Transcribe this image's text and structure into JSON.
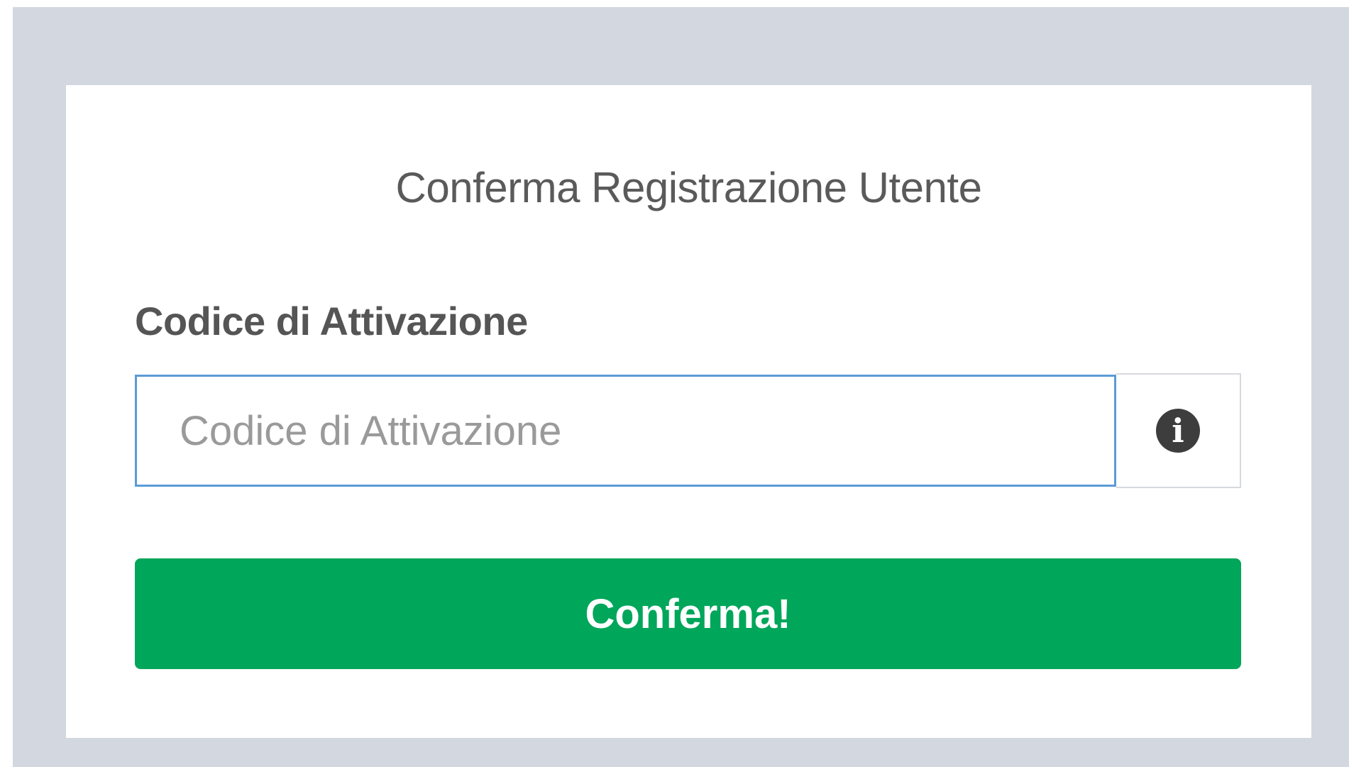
{
  "form": {
    "title": "Conferma Registrazione Utente",
    "activation_code": {
      "label": "Codice di Attivazione",
      "placeholder": "Codice di Attivazione",
      "value": "",
      "addon_icon": "info-icon",
      "addon_glyph": "i"
    },
    "submit_label": "Conferma!"
  },
  "colors": {
    "backdrop": "#d2d7e0",
    "card": "#ffffff",
    "input_focus_border": "#5b9bd5",
    "button": "#00a65a",
    "button_text": "#ffffff"
  }
}
